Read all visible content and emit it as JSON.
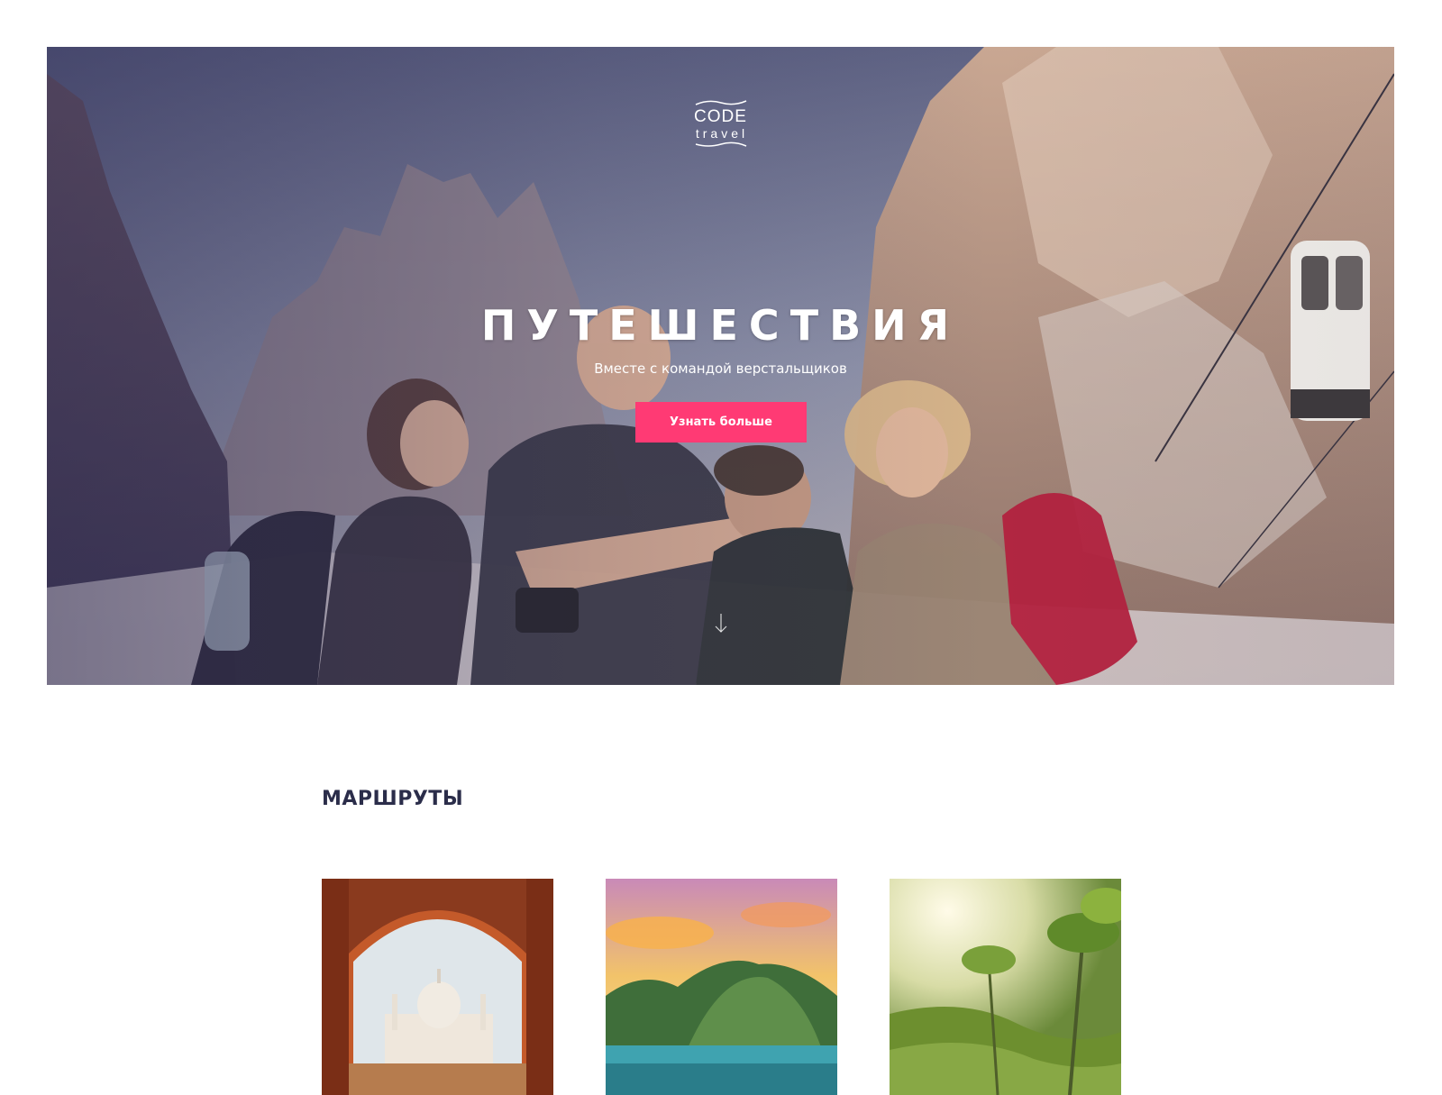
{
  "hero": {
    "logo": {
      "line1": "CODE",
      "line2": "travel"
    },
    "title": "ПУТЕШЕСТВИЯ",
    "subtitle": "Вместе с командой верстальщиков",
    "button_label": "Узнать больше",
    "scroll_icon": "arrow-down-icon"
  },
  "routes": {
    "heading": "МАРШРУТЫ",
    "cards": [
      {
        "image": "taj-mahal-arch-photo"
      },
      {
        "image": "tropical-island-bay-photo"
      },
      {
        "image": "rice-terrace-palms-photo"
      }
    ]
  },
  "colors": {
    "accent": "#ff3a74",
    "heading": "#2b2d4a",
    "background": "#ffffff"
  }
}
